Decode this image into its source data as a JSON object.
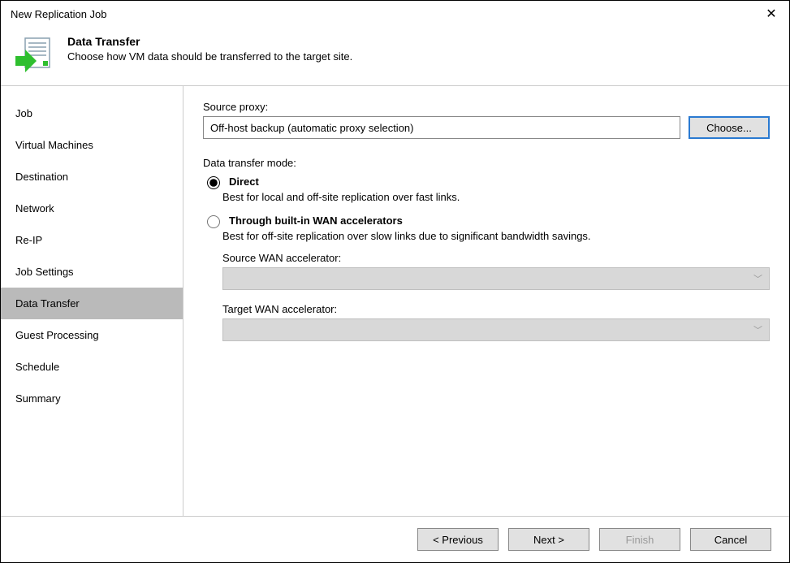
{
  "window": {
    "title": "New Replication Job"
  },
  "header": {
    "title": "Data Transfer",
    "subtitle": "Choose how VM data should be transferred to the target site."
  },
  "sidebar": {
    "items": [
      {
        "label": "Job",
        "active": false
      },
      {
        "label": "Virtual Machines",
        "active": false
      },
      {
        "label": "Destination",
        "active": false
      },
      {
        "label": "Network",
        "active": false
      },
      {
        "label": "Re-IP",
        "active": false
      },
      {
        "label": "Job Settings",
        "active": false
      },
      {
        "label": "Data Transfer",
        "active": true
      },
      {
        "label": "Guest Processing",
        "active": false
      },
      {
        "label": "Schedule",
        "active": false
      },
      {
        "label": "Summary",
        "active": false
      }
    ]
  },
  "main": {
    "source_proxy_label": "Source proxy:",
    "source_proxy_value": "Off-host backup (automatic proxy selection)",
    "choose_button": "Choose...",
    "mode_label": "Data transfer mode:",
    "direct": {
      "label": "Direct",
      "desc": "Best for local and off-site replication over fast links."
    },
    "wan": {
      "label": "Through built-in WAN accelerators",
      "desc": "Best for off-site replication over slow links due to significant bandwidth savings.",
      "source_label": "Source WAN accelerator:",
      "target_label": "Target WAN accelerator:"
    }
  },
  "footer": {
    "previous": "< Previous",
    "next": "Next >",
    "finish": "Finish",
    "cancel": "Cancel"
  }
}
